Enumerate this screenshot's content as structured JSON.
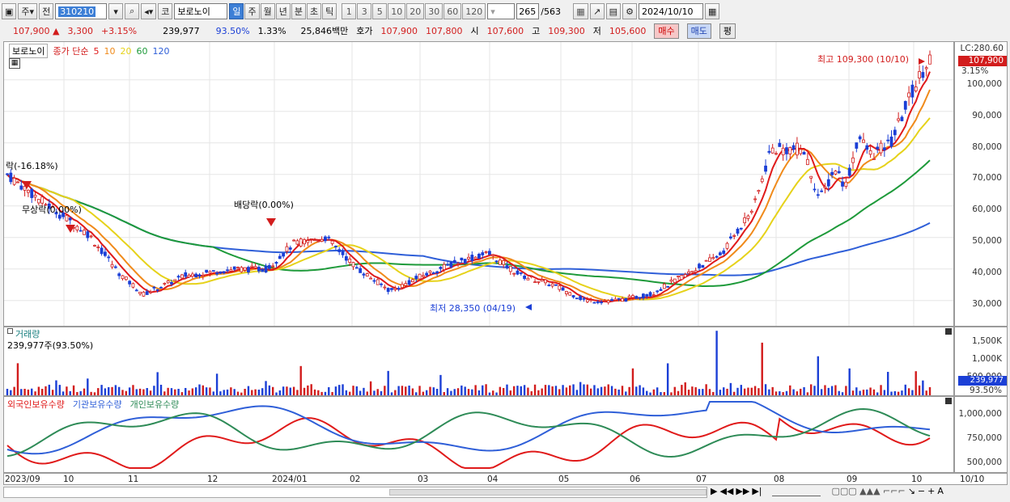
{
  "toolbar": {
    "type_label": "주",
    "prev_label": "전",
    "code": "310210",
    "market_label": "코",
    "name": "보로노이",
    "periods": [
      "일",
      "주",
      "월",
      "년",
      "분",
      "초",
      "틱"
    ],
    "period_selected": "일",
    "intervals": [
      "1",
      "3",
      "5",
      "10",
      "20",
      "30",
      "60",
      "120"
    ],
    "count": "265",
    "total": "/563",
    "date": "2024/10/10"
  },
  "quote": {
    "price": "107,900",
    "arrow": "▲",
    "change": "3,300",
    "rate": "+3.15%",
    "volume": "239,977",
    "vol_ratio": "93.50%",
    "turnover_rate": "1.33%",
    "amount": "25,846백만",
    "ask_label": "호가",
    "ask": "107,900",
    "bid": "107,800",
    "open_label": "시",
    "open": "107,600",
    "high_label": "고",
    "high": "109,300",
    "low_label": "저",
    "low": "105,600",
    "buy": "매수",
    "sell": "매도",
    "eval": "평"
  },
  "price_pane": {
    "title": "보로노이",
    "indicator": "종가 단순",
    "ma": [
      {
        "label": "5",
        "color": "#e01a1a"
      },
      {
        "label": "10",
        "color": "#f08a1a"
      },
      {
        "label": "20",
        "color": "#e6d21a"
      },
      {
        "label": "60",
        "color": "#1e9a3a"
      },
      {
        "label": "120",
        "color": "#2f5fd8"
      }
    ],
    "lc": "LC:280.60",
    "last": "107,900",
    "last_rate": "3.15%",
    "high_note": "최고 109,300 (10/10)",
    "low_note": "최저 28,350 (04/19)",
    "event1": "락(-16.18%)",
    "event2": "무상락(0.00%)",
    "event3": "배당락(0.00%)",
    "yticks": [
      "100,000",
      "90,000",
      "80,000",
      "70,000",
      "60,000",
      "50,000",
      "40,000",
      "30,000"
    ]
  },
  "volume_pane": {
    "title": "거래량",
    "value": "239,977주(93.50%)",
    "yticks": [
      "1,500K",
      "1,000K",
      "500,000"
    ],
    "last": "239,977",
    "last_ratio": "93.50%"
  },
  "holding_pane": {
    "legend": [
      "외국인보유수량",
      "기관보유수량",
      "개인보유수량"
    ],
    "colors": [
      "#e01a1a",
      "#2f5fd8",
      "#2e8b57"
    ],
    "yticks": [
      "1,000,000",
      "750,000",
      "500,000"
    ]
  },
  "xaxis": [
    "2023/09",
    "10",
    "11",
    "12",
    "2024/01",
    "02",
    "03",
    "04",
    "05",
    "06",
    "07",
    "08",
    "09",
    "10",
    "10/10"
  ],
  "colors": {
    "up": "#d21c1c",
    "down": "#1b3fd6",
    "ma5": "#e01a1a",
    "ma10": "#f08a1a",
    "ma20": "#e6d21a",
    "ma60": "#1e9a3a",
    "ma120": "#2f5fd8"
  }
}
